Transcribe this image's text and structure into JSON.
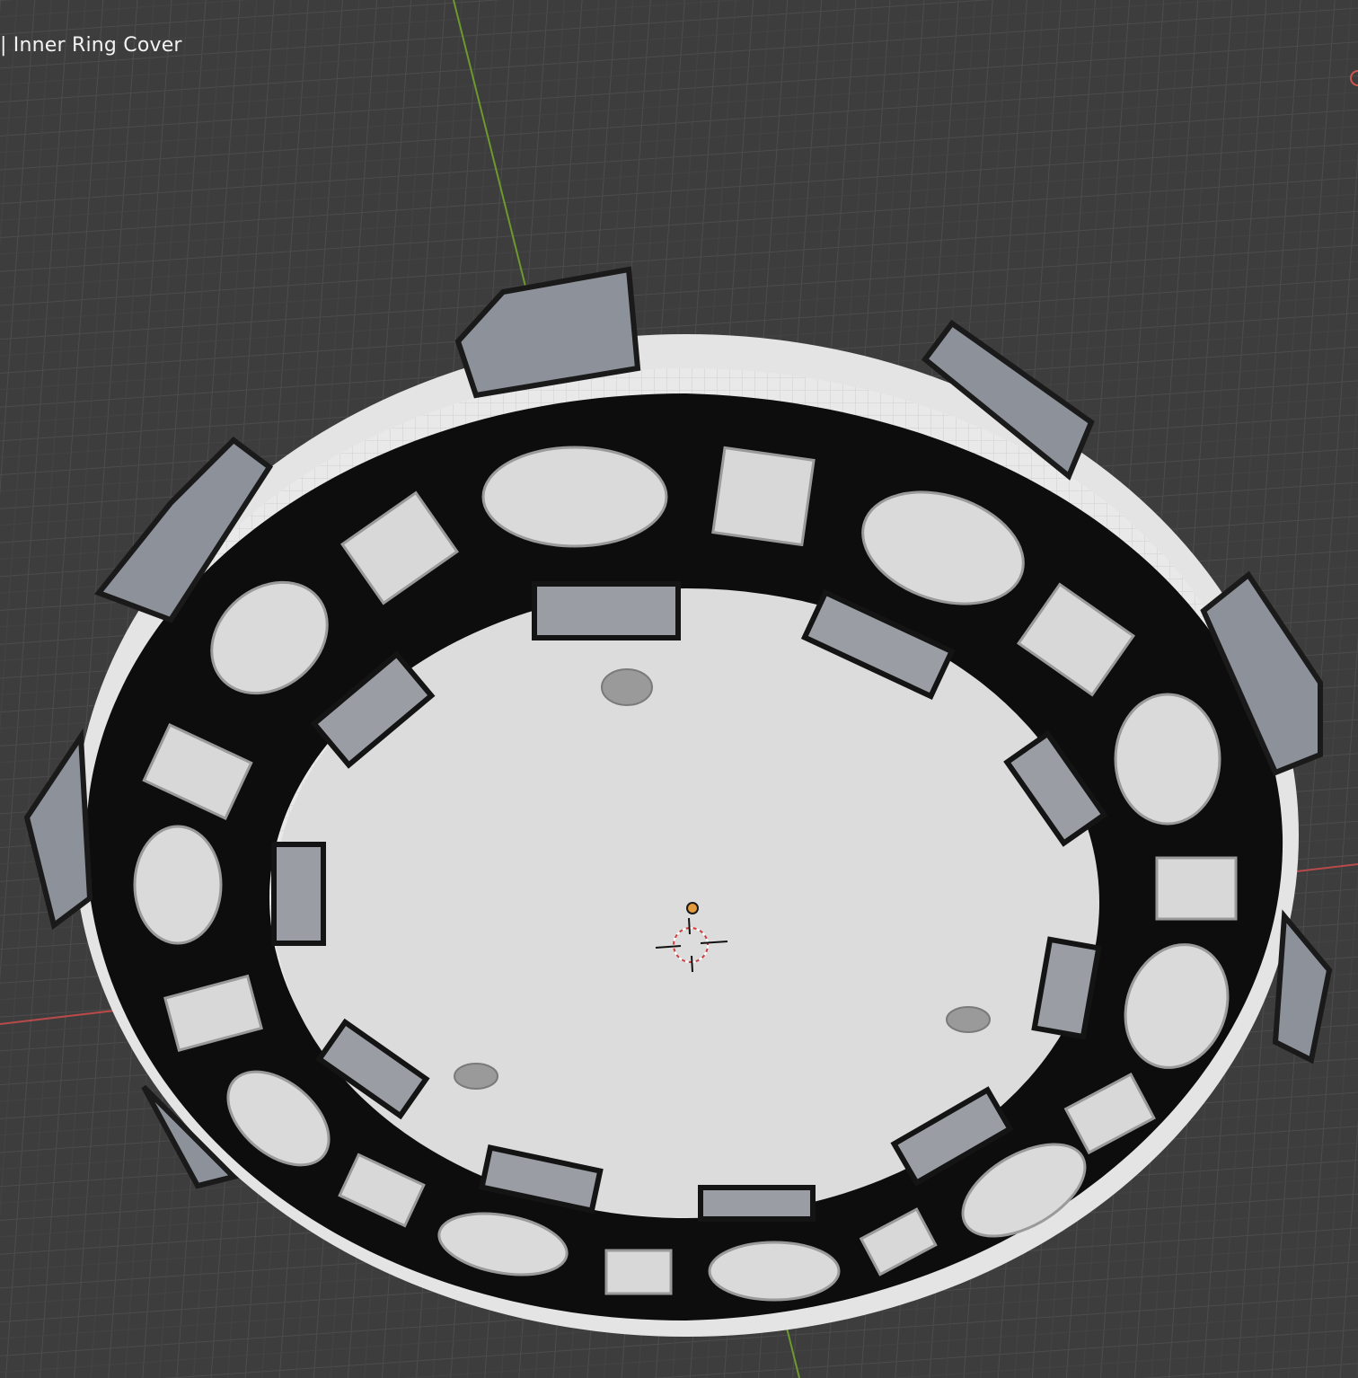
{
  "viewport": {
    "header_text": "| Inner Ring Cover",
    "background_color": "#3d3d3d",
    "grid_color": "#4a4a4a",
    "axis_x_color": "#c64a4a",
    "axis_y_color": "#6c9a2c",
    "origin_color": "#e59a3c"
  },
  "model": {
    "object_name": "Inner Ring Cover",
    "base_color": "#dcdcdc",
    "ring_color": "#0e0e0e",
    "clip_color": "#8a8f96"
  },
  "icons": {
    "origin": "origin-point-icon",
    "cursor": "3d-cursor-icon",
    "gizmo": "navigation-gizmo-icon"
  }
}
